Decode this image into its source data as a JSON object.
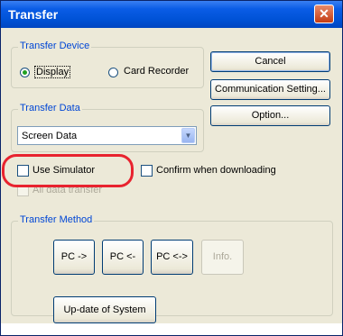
{
  "window": {
    "title": "Transfer"
  },
  "transfer_device": {
    "title": "Transfer Device",
    "options": [
      {
        "label": "Display",
        "selected": true
      },
      {
        "label": "Card Recorder",
        "selected": false
      }
    ]
  },
  "buttons": {
    "cancel": "Cancel",
    "communication_setting": "Communication Setting...",
    "option": "Option..."
  },
  "transfer_data": {
    "title": "Transfer Data",
    "selected": "Screen Data"
  },
  "checkboxes": {
    "use_simulator": {
      "label": "Use Simulator",
      "checked": false
    },
    "confirm_downloading": {
      "label": "Confirm when downloading",
      "checked": false
    },
    "all_data_transfer": {
      "label": "All data transfer",
      "checked": false,
      "enabled": false
    }
  },
  "transfer_method": {
    "title": "Transfer Method",
    "pc_to": "PC ->",
    "pc_from": "PC <-",
    "pc_both": "PC <->",
    "info": "Info.",
    "update_system": "Up-date of System"
  },
  "colors": {
    "accent": "#0046d5",
    "highlight": "#e8232f",
    "titlebar": "#0a5ce6"
  }
}
